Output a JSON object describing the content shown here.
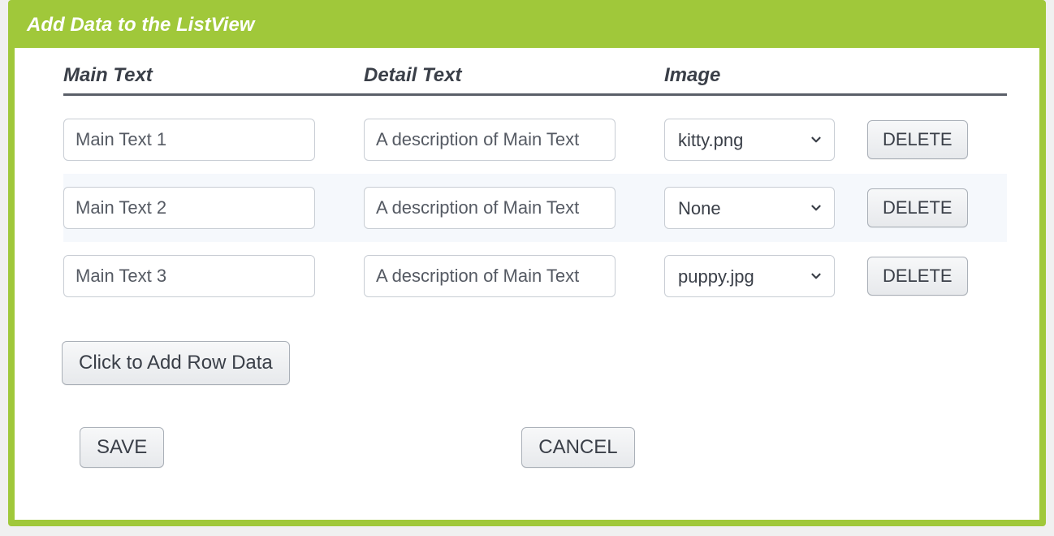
{
  "dialog": {
    "title": "Add Data to the ListView"
  },
  "columns": {
    "main": "Main Text",
    "detail": "Detail Text",
    "image": "Image"
  },
  "rows": [
    {
      "main": "Main Text 1",
      "detail": "A description of Main Text",
      "image": "kitty.png",
      "delete_label": "DELETE"
    },
    {
      "main": "Main Text 2",
      "detail": "A description of Main Text",
      "image": "None",
      "delete_label": "DELETE"
    },
    {
      "main": "Main Text 3",
      "detail": "A description of Main Text",
      "image": "puppy.jpg",
      "delete_label": "DELETE"
    }
  ],
  "buttons": {
    "add_row": "Click to Add Row Data",
    "save": "SAVE",
    "cancel": "CANCEL"
  }
}
